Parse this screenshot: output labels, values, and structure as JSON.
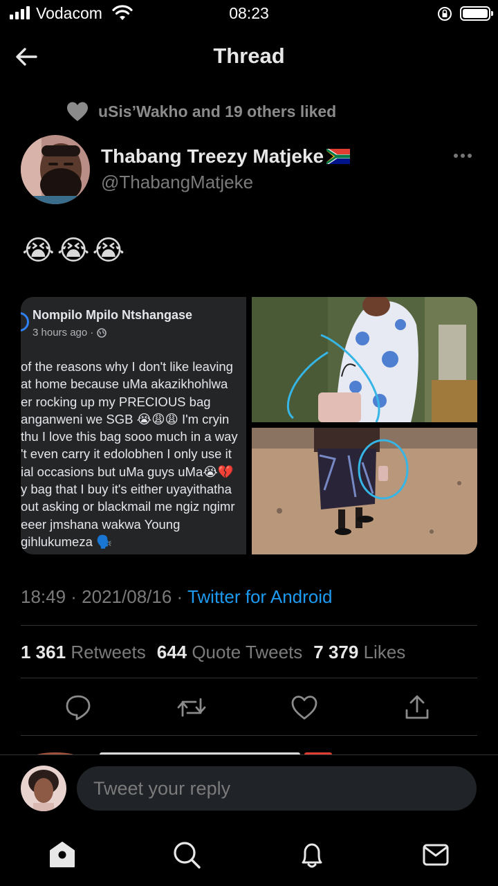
{
  "status_bar": {
    "carrier": "Vodacom",
    "time": "08:23"
  },
  "header": {
    "title": "Thread",
    "back_icon": "arrow-left-icon"
  },
  "social_context": {
    "icon": "heart-icon",
    "text": "uSis’Wakho and 19 others liked"
  },
  "tweet": {
    "author_name": "Thabang Treezy Matjeke",
    "author_flag": "south-africa-flag",
    "author_handle": "@ThabangMatjeke",
    "text": "😭😭😭",
    "timestamp": "18:49 · 2021/08/16 · ",
    "client": "Twitter for Android",
    "stats": {
      "retweets_count": "1 361",
      "retweets_label": "Retweets",
      "quotes_count": "644",
      "quotes_label": "Quote Tweets",
      "likes_count": "7 379",
      "likes_label": "Likes"
    },
    "media": {
      "fb_post": {
        "name": "Nompilo Mpilo Ntshangase",
        "meta": "3 hours ago ·",
        "lines": [
          "of the reasons why I don't like leaving",
          " at home because uMa akazikhohlwa",
          "er rocking up my PRECIOUS bag",
          "anganweni we SGB 😭😩😩 I'm cryin",
          "thu I love this bag sooo much in a way",
          "'t even carry it edolobhen I only use it",
          "ial occasions but uMa guys uMa😭💔",
          "y bag that I buy it's either uyayithatha",
          "out asking or blackmail me ngiz ngimr",
          "eeer jmshana wakwa Young",
          "gihlukumeza 🗣️"
        ]
      }
    }
  },
  "actions": [
    "reply-icon",
    "retweet-icon",
    "like-icon",
    "share-icon"
  ],
  "reply": {
    "placeholder": "Tweet your reply"
  },
  "nav": [
    "home-icon",
    "search-icon",
    "notifications-icon",
    "messages-icon"
  ],
  "colors": {
    "background": "#000000",
    "accent": "#1d9bf0",
    "muted": "#7b7b7b",
    "divider": "#2f3336"
  }
}
